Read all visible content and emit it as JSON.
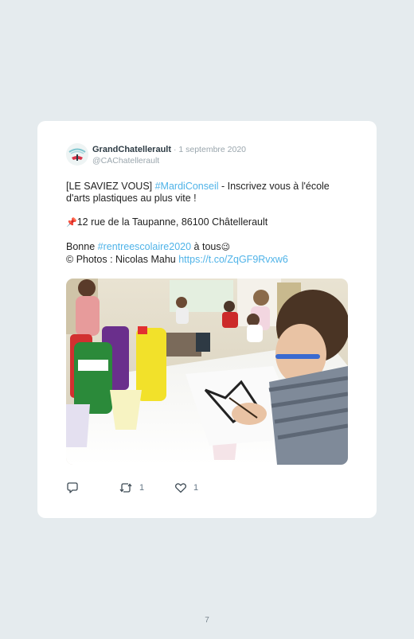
{
  "tweet": {
    "author_name": "GrandChatellerault",
    "separator": " · ",
    "date": "1 septembre 2020",
    "handle": "@CAChatellerault",
    "line1_prefix": "[LE SAVIEZ VOUS] ",
    "line1_hashtag": "#MardiConseil",
    "line1_suffix": " - Inscrivez vous à l'école d'arts plastiques au plus vite !",
    "address_emoji": "📌",
    "address": "12 rue de la Taupanne, 86100 Châtellerault",
    "greeting_prefix": "Bonne ",
    "greeting_hashtag": "#rentreescolaire2020",
    "greeting_suffix": " à tous",
    "wink_emoji": "😉",
    "copyright_symbol": "©",
    "photo_credit": " Photos : Nicolas Mahu ",
    "link": "https://t.co/ZqGF9Rvxw6",
    "photo_alt": "Children painting at the école d'arts plastiques"
  },
  "actions": {
    "reply_icon": "reply-icon",
    "retweet_icon": "retweet-icon",
    "retweet_count": "1",
    "like_icon": "heart-icon",
    "like_count": "1"
  },
  "page_number": "7",
  "colors": {
    "background": "#e5ebee",
    "card": "#ffffff",
    "link": "#4fb3e8",
    "muted": "#9aa6ad"
  }
}
